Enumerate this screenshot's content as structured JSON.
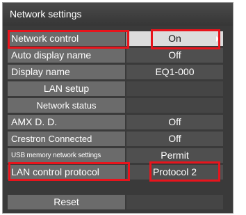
{
  "window": {
    "title": "Network settings"
  },
  "rows": [
    {
      "label": "Network control",
      "value": "On"
    },
    {
      "label": "Auto display name",
      "value": "Off"
    },
    {
      "label": "Display name",
      "value": "EQ1-000"
    },
    {
      "label": "LAN setup",
      "value": ""
    },
    {
      "label": "Network status",
      "value": ""
    },
    {
      "label": "AMX D. D.",
      "value": "Off"
    },
    {
      "label": "Crestron Connected",
      "value": "Off"
    },
    {
      "label": "USB memory network settings",
      "value": "Permit"
    },
    {
      "label": "LAN control protocol",
      "value": "Protocol 2"
    }
  ],
  "reset": {
    "label": "Reset"
  },
  "colors": {
    "highlight": "#e8141c",
    "selected_bg": "#dcdcdc"
  }
}
